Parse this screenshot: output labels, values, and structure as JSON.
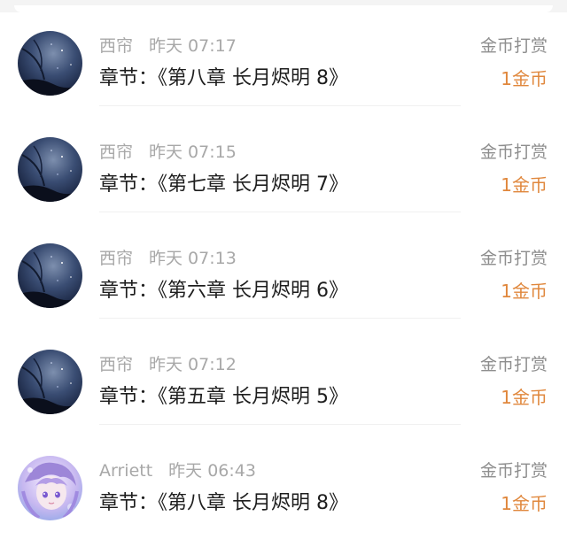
{
  "items": [
    {
      "user": "西帘",
      "time": "昨天 07:17",
      "chapter": "章节：《第八章 长月烬明 8》",
      "reward_type": "金币打赏",
      "reward_amount": "1金币",
      "avatar": "night-sky"
    },
    {
      "user": "西帘",
      "time": "昨天 07:15",
      "chapter": "章节：《第七章 长月烬明 7》",
      "reward_type": "金币打赏",
      "reward_amount": "1金币",
      "avatar": "night-sky"
    },
    {
      "user": "西帘",
      "time": "昨天 07:13",
      "chapter": "章节：《第六章 长月烬明 6》",
      "reward_type": "金币打赏",
      "reward_amount": "1金币",
      "avatar": "night-sky"
    },
    {
      "user": "西帘",
      "time": "昨天 07:12",
      "chapter": "章节：《第五章 长月烬明 5》",
      "reward_type": "金币打赏",
      "reward_amount": "1金币",
      "avatar": "night-sky"
    },
    {
      "user": "Arriett",
      "time": "昨天 06:43",
      "chapter": "章节：《第八章 长月烬明 8》",
      "reward_type": "金币打赏",
      "reward_amount": "1金币",
      "avatar": "anime-girl"
    }
  ],
  "colors": {
    "reward_amount": "#e0873c",
    "meta_text": "#a8a8a8",
    "primary_text": "#1e1e1e"
  }
}
